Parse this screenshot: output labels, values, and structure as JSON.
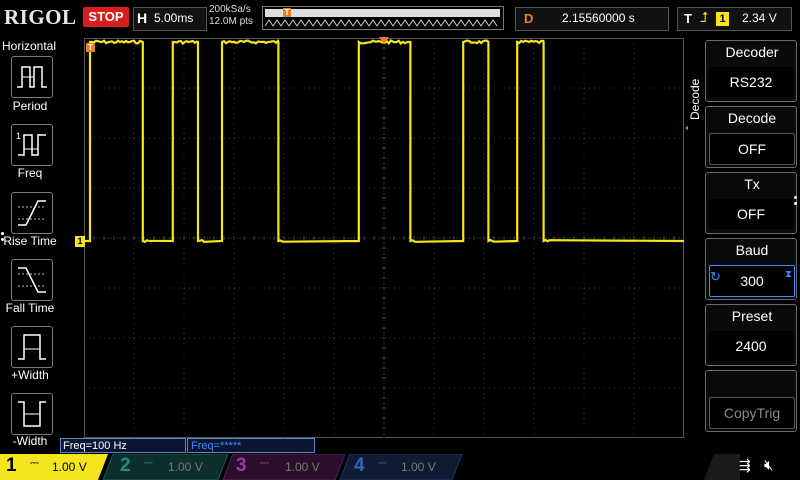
{
  "topbar": {
    "logo": "RIGOL",
    "run_state": "STOP",
    "timebase_label": "H",
    "timebase_value": "5.00ms",
    "sample_rate": "200kSa/s",
    "memory_depth": "12.0M pts",
    "trigger_marker": "T",
    "delay_label": "D",
    "delay_value": "2.15560000 s",
    "trigger_label": "T",
    "trigger_source": "1",
    "trigger_level": "2.34 V"
  },
  "left_menu": {
    "title": "Horizontal",
    "items": [
      {
        "label": "Period",
        "icon": "period-icon"
      },
      {
        "label": "Freq",
        "icon": "freq-icon"
      },
      {
        "label": "Rise Time",
        "icon": "rise-time-icon"
      },
      {
        "label": "Fall Time",
        "icon": "fall-time-icon"
      },
      {
        "label": "+Width",
        "icon": "plus-width-icon"
      },
      {
        "label": "-Width",
        "icon": "minus-width-icon"
      }
    ]
  },
  "right_menu": {
    "vertical_title": "Decode",
    "items": [
      {
        "label": "Decoder",
        "value": "RS232"
      },
      {
        "label": "Decode",
        "value": "OFF"
      },
      {
        "label": "Tx",
        "value": "OFF"
      },
      {
        "label": "Baud",
        "value": "300"
      },
      {
        "label": "Preset",
        "value": "2400"
      },
      {
        "label": "",
        "value": "CopyTrig"
      }
    ]
  },
  "measurements": {
    "freq1": "Freq=100 Hz",
    "freq2": "Freq=*****"
  },
  "channel_marker": "1",
  "trigger_pos_marker": "T",
  "channels": [
    {
      "num": "1",
      "scale": "1.00 V",
      "color": "#f5e51c"
    },
    {
      "num": "2",
      "scale": "1.00 V",
      "color": "#00b7a0"
    },
    {
      "num": "3",
      "scale": "1.00 V",
      "color": "#d040c8"
    },
    {
      "num": "4",
      "scale": "1.00 V",
      "color": "#2f6fe0"
    }
  ],
  "waveform": {
    "color": "#f5e51c",
    "pulses_ms": [
      [
        0.5,
        4.9
      ],
      [
        7.4,
        9.5
      ],
      [
        11.5,
        16.2
      ],
      [
        22.9,
        27.2
      ],
      [
        31.6,
        33.7
      ],
      [
        36.1,
        38.3
      ]
    ],
    "high_level_div": 8.0,
    "low_level_div": 4.0,
    "time_span_ms": 50.0
  },
  "colors": {
    "grid": "#3a3a3a",
    "accent_blue": "#3b8cff",
    "trigger_orange": "#ee7d1e",
    "stop_red": "#d81d1d"
  }
}
